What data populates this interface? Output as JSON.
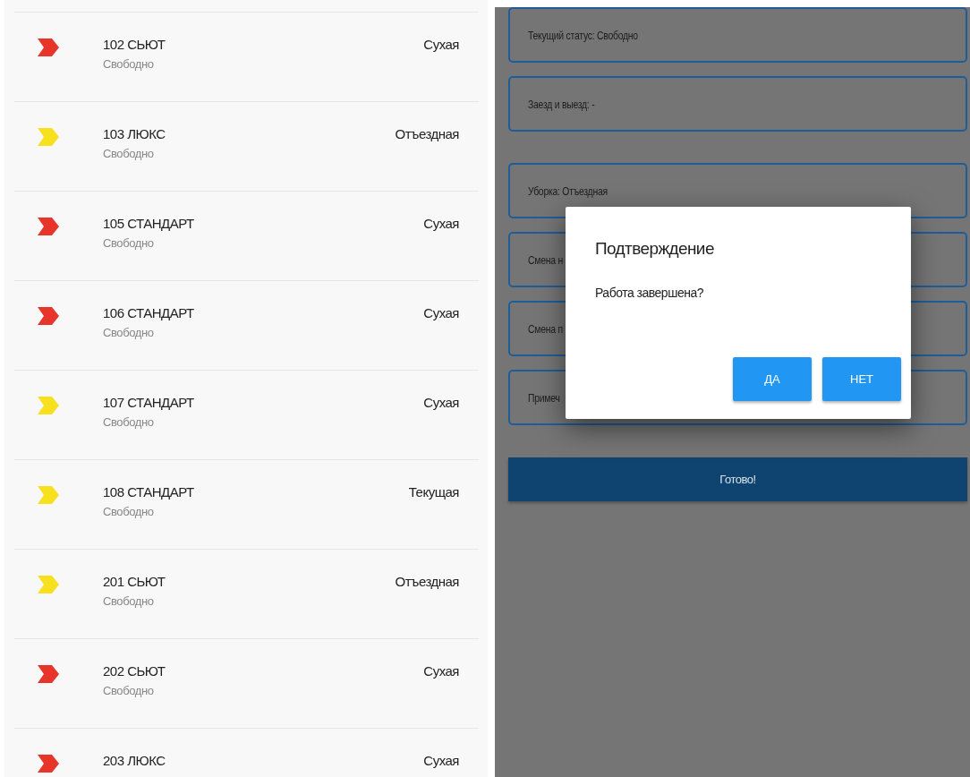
{
  "rooms": [
    {
      "name": "102 СЬЮТ",
      "status": "Свободно",
      "cleaning": "Сухая",
      "color": "#e8352a"
    },
    {
      "name": "103 ЛЮКС",
      "status": "Свободно",
      "cleaning": "Отъездная",
      "color": "#f7e11e"
    },
    {
      "name": "105 СТАНДАРТ",
      "status": "Свободно",
      "cleaning": "Сухая",
      "color": "#e8352a"
    },
    {
      "name": "106 СТАНДАРТ",
      "status": "Свободно",
      "cleaning": "Сухая",
      "color": "#e8352a"
    },
    {
      "name": "107 СТАНДАРТ",
      "status": "Свободно",
      "cleaning": "Сухая",
      "color": "#f7e11e"
    },
    {
      "name": "108 СТАНДАРТ",
      "status": "Свободно",
      "cleaning": "Текущая",
      "color": "#f7e11e"
    },
    {
      "name": "201 СЬЮТ",
      "status": "Свободно",
      "cleaning": "Отъездная",
      "color": "#f7e11e"
    },
    {
      "name": "202 СЬЮТ",
      "status": "Свободно",
      "cleaning": "Сухая",
      "color": "#e8352a"
    },
    {
      "name": "203 ЛЮКС",
      "cleaning": "Сухая",
      "color": "#e8352a"
    }
  ],
  "details": {
    "field_groups": [
      [
        "Текущий статус: Свободно",
        "Заезд и выезд:  -"
      ],
      [
        "Уборка: Отъездная",
        "Смена н",
        "Смена п",
        "Примеч"
      ]
    ],
    "done_button": "Готово!"
  },
  "dialog": {
    "title": "Подтверждение",
    "message": "Работа завершена?",
    "buttons": [
      "ДА",
      "НЕТ"
    ]
  }
}
